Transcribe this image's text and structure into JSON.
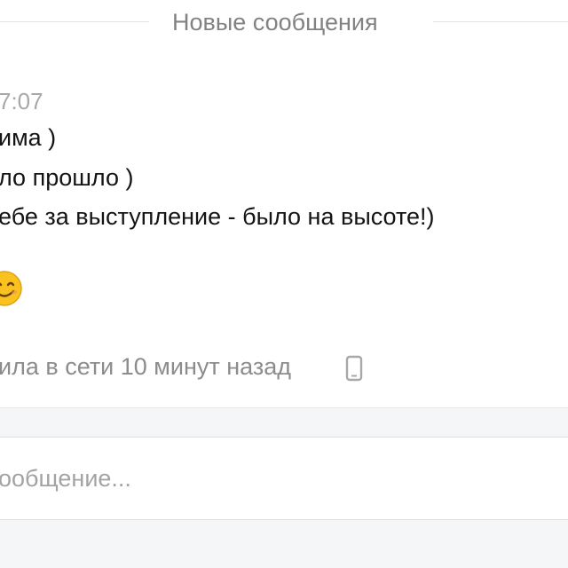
{
  "chat": {
    "divider_label": "Новые сообщения",
    "message_time": "7:07",
    "messages": [
      "има )",
      "ло прошло )",
      "ебе за выступление - было на высоте!)"
    ],
    "emoji": "smiling-face-emoji"
  },
  "status": {
    "text": "ила в сети 10 минут назад",
    "device_icon": "mobile-phone-icon"
  },
  "composer": {
    "placeholder": "ообщение..."
  },
  "colors": {
    "divider": "#e1e4e8",
    "muted_text": "#828282",
    "emoji_face": "#f9c21f",
    "panel_background": "#f5f6f8"
  }
}
